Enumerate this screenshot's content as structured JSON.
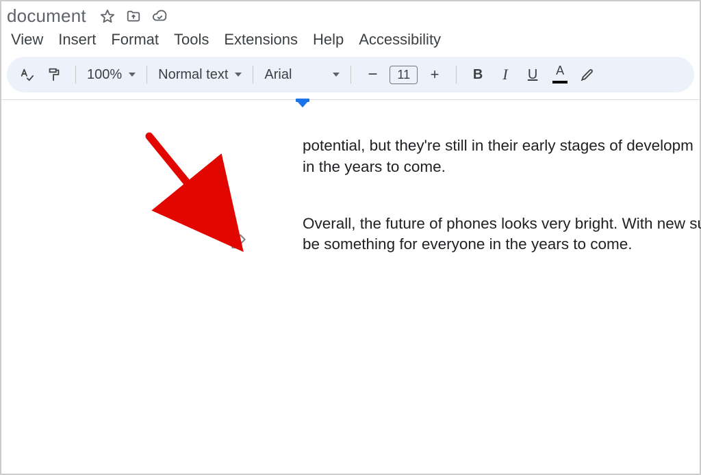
{
  "header": {
    "title": "document"
  },
  "menubar": {
    "items": [
      "View",
      "Insert",
      "Format",
      "Tools",
      "Extensions",
      "Help",
      "Accessibility"
    ]
  },
  "toolbar": {
    "zoom": "100%",
    "style": "Normal text",
    "font": "Arial",
    "fontsize": "11",
    "minus": "−",
    "plus": "+",
    "bold": "B",
    "italic": "I",
    "underline": "U",
    "textcolor": "A"
  },
  "document": {
    "paragraphs": [
      "potential, but they're still in their early stages of developm\nin the years to come.",
      "Overall, the future of phones looks very bright. With new sure to be something for everyone in the years to come."
    ]
  }
}
